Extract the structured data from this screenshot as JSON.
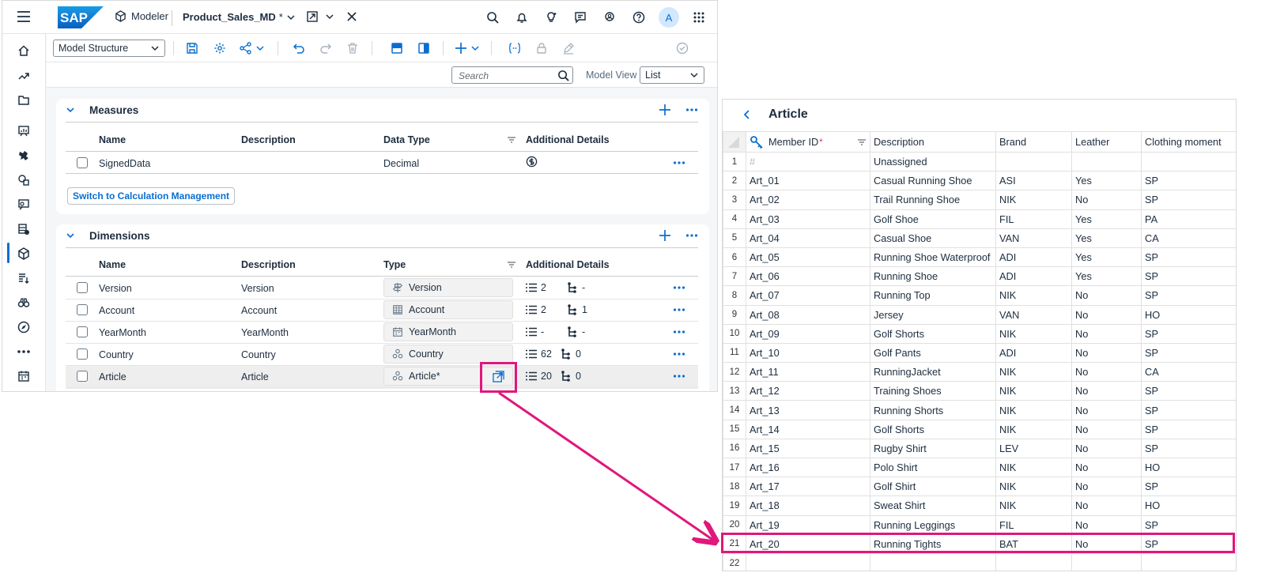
{
  "shell": {
    "logo_text": "SAP",
    "app_name": "Modeler",
    "doc_title": "Product_Sales_MD",
    "dirty_mark": "*",
    "avatar_initial": "A"
  },
  "toolbar": {
    "view_select_value": "Model Structure"
  },
  "filterbar": {
    "search_placeholder": "Search",
    "model_view_label": "Model View",
    "model_view_value": "List"
  },
  "measures": {
    "title": "Measures",
    "columns": [
      "Name",
      "Description",
      "Data Type",
      "Additional Details"
    ],
    "rows": [
      {
        "name": "SignedData",
        "description": "",
        "data_type": "Decimal"
      }
    ],
    "calc_button": "Switch to Calculation Management"
  },
  "dimensions": {
    "title": "Dimensions",
    "columns": [
      "Name",
      "Description",
      "Type",
      "Additional Details"
    ],
    "rows": [
      {
        "name": "Version",
        "description": "Version",
        "type": "Version",
        "type_icon": "version-icon",
        "attr_count": "2",
        "hier_count": "-"
      },
      {
        "name": "Account",
        "description": "Account",
        "type": "Account",
        "type_icon": "account-icon",
        "attr_count": "2",
        "hier_count": "1"
      },
      {
        "name": "YearMonth",
        "description": "YearMonth",
        "type": "YearMonth",
        "type_icon": "calendar-icon",
        "attr_count": "-",
        "hier_count": "-"
      },
      {
        "name": "Country",
        "description": "Country",
        "type": "Country",
        "type_icon": "generic-dimension-icon",
        "attr_count": "62",
        "hier_count": "0"
      },
      {
        "name": "Article",
        "description": "Article",
        "type": "Article*",
        "type_icon": "generic-dimension-icon",
        "attr_count": "20",
        "hier_count": "0"
      }
    ]
  },
  "grid": {
    "title": "Article",
    "columns": [
      "Member ID",
      "Description",
      "Brand",
      "Leather",
      "Clothing moment"
    ],
    "required_mark": "*",
    "rows": [
      [
        "1",
        "#",
        "Unassigned",
        "",
        "",
        ""
      ],
      [
        "2",
        "Art_01",
        "Casual Running Shoe",
        "ASI",
        "Yes",
        "SP"
      ],
      [
        "3",
        "Art_02",
        "Trail Running Shoe",
        "NIK",
        "No",
        "SP"
      ],
      [
        "4",
        "Art_03",
        "Golf Shoe",
        "FIL",
        "Yes",
        "PA"
      ],
      [
        "5",
        "Art_04",
        "Casual Shoe",
        "VAN",
        "Yes",
        "CA"
      ],
      [
        "6",
        "Art_05",
        "Running Shoe Waterproof",
        "ADI",
        "Yes",
        "SP"
      ],
      [
        "7",
        "Art_06",
        "Running Shoe",
        "ADI",
        "Yes",
        "SP"
      ],
      [
        "8",
        "Art_07",
        "Running Top",
        "NIK",
        "No",
        "SP"
      ],
      [
        "9",
        "Art_08",
        "Jersey",
        "VAN",
        "No",
        "HO"
      ],
      [
        "10",
        "Art_09",
        "Golf Shorts",
        "NIK",
        "No",
        "SP"
      ],
      [
        "11",
        "Art_10",
        "Golf Pants",
        "ADI",
        "No",
        "SP"
      ],
      [
        "12",
        "Art_11",
        "RunningJacket",
        "NIK",
        "No",
        "CA"
      ],
      [
        "13",
        "Art_12",
        "Training Shoes",
        "NIK",
        "No",
        "SP"
      ],
      [
        "14",
        "Art_13",
        "Running Shorts",
        "NIK",
        "No",
        "SP"
      ],
      [
        "15",
        "Art_14",
        "Golf Shorts",
        "NIK",
        "No",
        "SP"
      ],
      [
        "16",
        "Art_15",
        "Rugby Shirt",
        "LEV",
        "No",
        "SP"
      ],
      [
        "17",
        "Art_16",
        "Polo Shirt",
        "NIK",
        "No",
        "HO"
      ],
      [
        "18",
        "Art_17",
        "Golf Shirt",
        "NIK",
        "No",
        "SP"
      ],
      [
        "19",
        "Art_18",
        "Sweat Shirt",
        "NIK",
        "No",
        "HO"
      ],
      [
        "20",
        "Art_19",
        "Running Leggings",
        "FIL",
        "No",
        "SP"
      ],
      [
        "21",
        "Art_20",
        "Running Tights",
        "BAT",
        "No",
        "SP"
      ],
      [
        "22",
        "",
        "",
        "",
        "",
        ""
      ]
    ]
  },
  "colors": {
    "accent": "#0a6ed1",
    "highlight": "#e0177c",
    "logo_blue": "#0a6ed1"
  }
}
